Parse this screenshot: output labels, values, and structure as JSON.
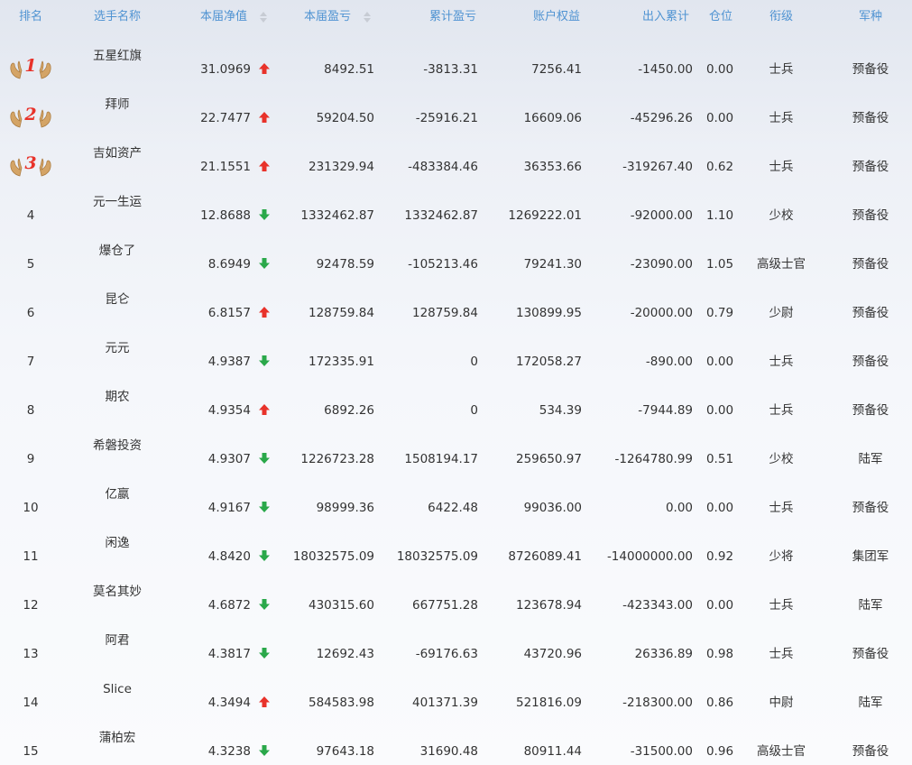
{
  "colors": {
    "header_text": "#4f93d2",
    "body_text": "#333333",
    "arrow_up": "#e8322a",
    "arrow_down": "#2aa84a",
    "badge_wing": "#d4a466"
  },
  "columns": {
    "rank": "排名",
    "player": "选手名称",
    "nav": "本届净值",
    "pnl": "本届盈亏",
    "cum_pnl": "累计盈亏",
    "equity": "账户权益",
    "flow": "出入累计",
    "position": "仓位",
    "grade": "衔级",
    "branch": "军种"
  },
  "rows": [
    {
      "rank": "1",
      "name": "五星红旗",
      "nav": "31.0969",
      "trend": "up",
      "pnl": "8492.51",
      "cum": "-3813.31",
      "equity": "7256.41",
      "flow": "-1450.00",
      "pos": "0.00",
      "grade": "士兵",
      "branch": "预备役"
    },
    {
      "rank": "2",
      "name": "拜师",
      "nav": "22.7477",
      "trend": "up",
      "pnl": "59204.50",
      "cum": "-25916.21",
      "equity": "16609.06",
      "flow": "-45296.26",
      "pos": "0.00",
      "grade": "士兵",
      "branch": "预备役"
    },
    {
      "rank": "3",
      "name": "吉如资产",
      "nav": "21.1551",
      "trend": "up",
      "pnl": "231329.94",
      "cum": "-483384.46",
      "equity": "36353.66",
      "flow": "-319267.40",
      "pos": "0.62",
      "grade": "士兵",
      "branch": "预备役"
    },
    {
      "rank": "4",
      "name": "元一生运",
      "nav": "12.8688",
      "trend": "down",
      "pnl": "1332462.87",
      "cum": "1332462.87",
      "equity": "1269222.01",
      "flow": "-92000.00",
      "pos": "1.10",
      "grade": "少校",
      "branch": "预备役"
    },
    {
      "rank": "5",
      "name": "爆仓了",
      "nav": "8.6949",
      "trend": "down",
      "pnl": "92478.59",
      "cum": "-105213.46",
      "equity": "79241.30",
      "flow": "-23090.00",
      "pos": "1.05",
      "grade": "高级士官",
      "branch": "预备役"
    },
    {
      "rank": "6",
      "name": "昆仑",
      "nav": "6.8157",
      "trend": "up",
      "pnl": "128759.84",
      "cum": "128759.84",
      "equity": "130899.95",
      "flow": "-20000.00",
      "pos": "0.79",
      "grade": "少尉",
      "branch": "预备役"
    },
    {
      "rank": "7",
      "name": "元元",
      "nav": "4.9387",
      "trend": "down",
      "pnl": "172335.91",
      "cum": "0",
      "equity": "172058.27",
      "flow": "-890.00",
      "pos": "0.00",
      "grade": "士兵",
      "branch": "预备役"
    },
    {
      "rank": "8",
      "name": "期农",
      "nav": "4.9354",
      "trend": "up",
      "pnl": "6892.26",
      "cum": "0",
      "equity": "534.39",
      "flow": "-7944.89",
      "pos": "0.00",
      "grade": "士兵",
      "branch": "预备役"
    },
    {
      "rank": "9",
      "name": "希磐投资",
      "nav": "4.9307",
      "trend": "down",
      "pnl": "1226723.28",
      "cum": "1508194.17",
      "equity": "259650.97",
      "flow": "-1264780.99",
      "pos": "0.51",
      "grade": "少校",
      "branch": "陆军"
    },
    {
      "rank": "10",
      "name": "亿嬴",
      "nav": "4.9167",
      "trend": "down",
      "pnl": "98999.36",
      "cum": "6422.48",
      "equity": "99036.00",
      "flow": "0.00",
      "pos": "0.00",
      "grade": "士兵",
      "branch": "预备役"
    },
    {
      "rank": "11",
      "name": "闲逸",
      "nav": "4.8420",
      "trend": "down",
      "pnl": "18032575.09",
      "cum": "18032575.09",
      "equity": "8726089.41",
      "flow": "-14000000.00",
      "pos": "0.92",
      "grade": "少将",
      "branch": "集团军"
    },
    {
      "rank": "12",
      "name": "莫名其妙",
      "nav": "4.6872",
      "trend": "down",
      "pnl": "430315.60",
      "cum": "667751.28",
      "equity": "123678.94",
      "flow": "-423343.00",
      "pos": "0.00",
      "grade": "士兵",
      "branch": "陆军"
    },
    {
      "rank": "13",
      "name": "阿君",
      "nav": "4.3817",
      "trend": "down",
      "pnl": "12692.43",
      "cum": "-69176.63",
      "equity": "43720.96",
      "flow": "26336.89",
      "pos": "0.98",
      "grade": "士兵",
      "branch": "预备役"
    },
    {
      "rank": "14",
      "name": "Slice",
      "nav": "4.3494",
      "trend": "up",
      "pnl": "584583.98",
      "cum": "401371.39",
      "equity": "521816.09",
      "flow": "-218300.00",
      "pos": "0.86",
      "grade": "中尉",
      "branch": "陆军"
    },
    {
      "rank": "15",
      "name": "蒲柏宏",
      "nav": "4.3238",
      "trend": "down",
      "pnl": "97643.18",
      "cum": "31690.48",
      "equity": "80911.44",
      "flow": "-31500.00",
      "pos": "0.96",
      "grade": "高级士官",
      "branch": "预备役"
    }
  ]
}
